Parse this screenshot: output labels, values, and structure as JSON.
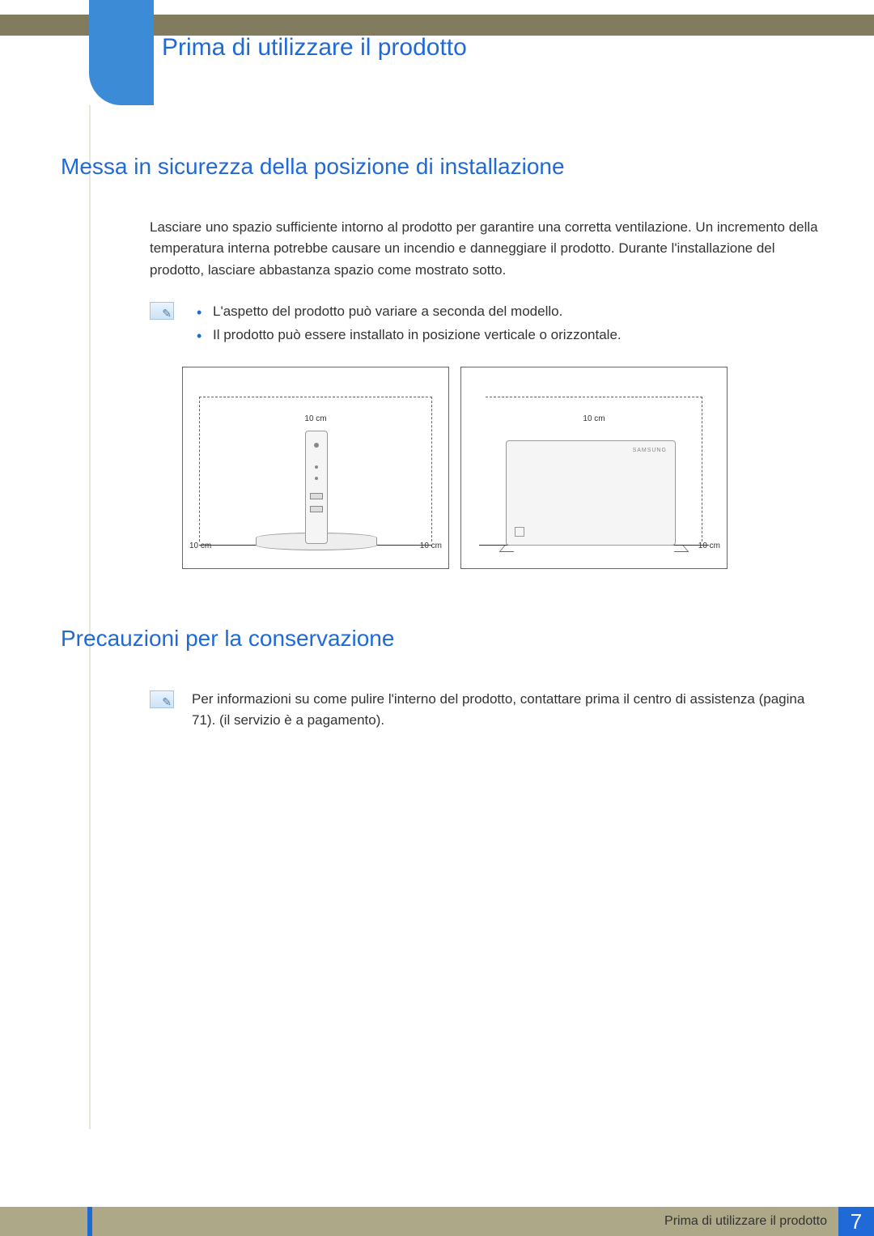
{
  "chapter_title": "Prima di utilizzare il prodotto",
  "section1": {
    "heading": "Messa in sicurezza della posizione di installazione",
    "para": "Lasciare uno spazio sufficiente intorno al prodotto per garantire una corretta ventilazione. Un incremento della temperatura interna potrebbe causare un incendio e danneggiare il prodotto. Durante l'installazione del prodotto, lasciare abbastanza spazio come mostrato sotto.",
    "notes": [
      "L'aspetto del prodotto può variare a seconda del modello.",
      "Il prodotto può essere installato in posizione verticale o orizzontale."
    ],
    "diagram": {
      "clearance_top": "10 cm",
      "clearance_left": "10 cm",
      "clearance_right": "10 cm"
    }
  },
  "section2": {
    "heading": "Precauzioni per la conservazione",
    "note": "Per informazioni su come pulire l'interno del prodotto, contattare prima il centro di assistenza (pagina 71). (il servizio è a pagamento)."
  },
  "footer": {
    "text": "Prima di utilizzare il prodotto",
    "page": "7"
  }
}
